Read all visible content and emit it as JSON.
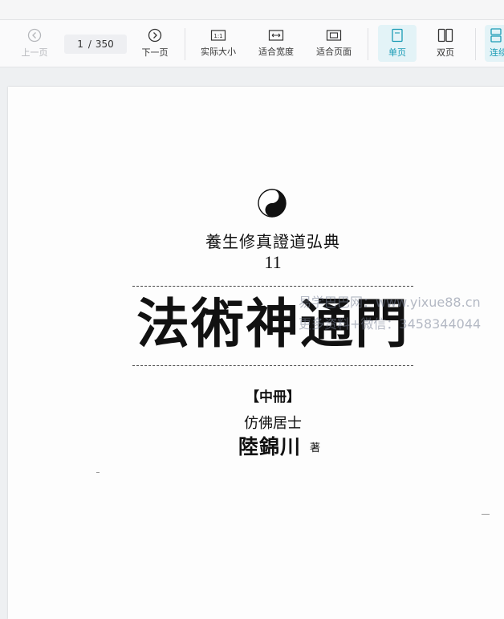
{
  "toolbar": {
    "prev": "上一页",
    "page_current": "1",
    "page_sep": "/",
    "page_total": "350",
    "next": "下一页",
    "actual_size": "实际大小",
    "fit_width": "适合宽度",
    "fit_page": "适合页面",
    "single_page": "单页",
    "double_page": "双页",
    "continuous": "连续"
  },
  "icons": {
    "prev": "chevron-left-circle-icon",
    "next": "chevron-right-circle-icon",
    "actual_size": "one-to-one-icon",
    "fit_width": "fit-width-icon",
    "fit_page": "fit-page-icon",
    "single_page": "single-page-icon",
    "double_page": "double-page-icon",
    "continuous": "continuous-page-icon"
  },
  "colors": {
    "accent": "#1a9bb5",
    "accent_bg": "#e3f3f7"
  },
  "document": {
    "series_title": "養生修真證道弘典",
    "series_number": "11",
    "main_title": "法術神通門",
    "volume": "【中冊】",
    "author_prefix": "仿佛居士",
    "author": "陸錦川",
    "author_suffix": "著"
  },
  "watermark": {
    "line1": "易学巴巴网：www.yixue88.cn",
    "line2": "更多资料+微信：3458344044"
  }
}
